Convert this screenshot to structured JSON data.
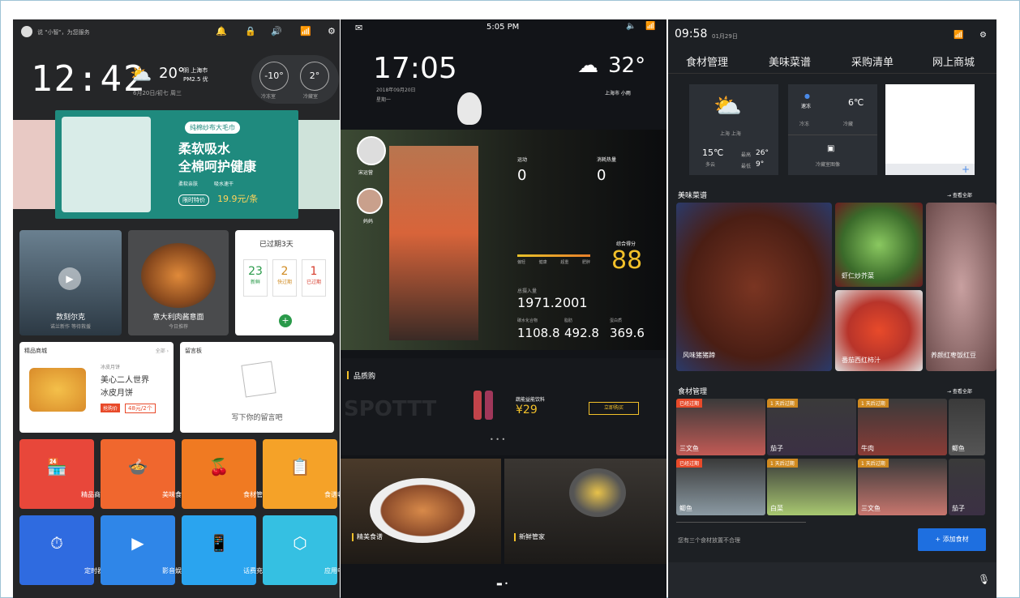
{
  "p1": {
    "status_text": "说 \"小智\"，为您服务",
    "time": "12:42",
    "temp": "20°",
    "weather_mini": "阴  上海市",
    "pm": "PM2.5  优",
    "date": "6月20日/初七  周三",
    "fridge1_temp": "-10°",
    "fridge1_label": "冷冻室",
    "fridge2_temp": "2°",
    "fridge2_label": "冷藏室",
    "banner": {
      "tag": "纯棉纱布大毛巾",
      "line1": "柔软吸水",
      "line2": "全棉呵护健康",
      "feat1": "柔软亲肤",
      "feat2": "吸水速干",
      "price_label": "限时特价",
      "price": "19.9元/条"
    },
    "video1_title": "敦刻尔克",
    "video1_sub": "诺兰新作 等待救援",
    "recipe_title": "意大利肉酱意面",
    "recipe_sub": "今日推荐",
    "expiry": {
      "title": "已过期3天",
      "c1_num": "23",
      "c1_label": "新鲜",
      "c2_num": "2",
      "c2_label": "快过期",
      "c3_num": "1",
      "c3_label": "已过期",
      "add": "+"
    },
    "shop": {
      "title": "精品商城",
      "more": "全部 ›",
      "slogan1": "美心二人世界",
      "slogan2": "冰皮月饼",
      "small": "冰皮月饼",
      "buy": "抢购价",
      "price": "48元/2个"
    },
    "memo": {
      "title": "留言板",
      "hint": "写下你的留言吧"
    },
    "quick": [
      {
        "icon": "🏪",
        "label": "精品商城"
      },
      {
        "icon": "🍲",
        "label": "美味食谱"
      },
      {
        "icon": "🍒",
        "label": "食材管理"
      },
      {
        "icon": "📋",
        "label": "食谱收藏"
      },
      {
        "icon": "⏱",
        "label": "定时器"
      },
      {
        "icon": "▶",
        "label": "影音娱乐"
      },
      {
        "icon": "📱",
        "label": "话费充值"
      },
      {
        "icon": "⬡",
        "label": "应用中心"
      }
    ]
  },
  "p2": {
    "status_time": "5:05 PM",
    "time": "17:05",
    "date": "2018年09月20日",
    "weekday": "星期一",
    "temp": "32°",
    "city": "上海市   小雨",
    "user1": "宋运营",
    "user2": "妈妈",
    "sport_label": "运动",
    "sport_val": "0",
    "cal_label": "消耗热量",
    "cal_val": "0",
    "score_label": "综合得分",
    "score": "88",
    "bar_vals": [
      "偏轻",
      "健康",
      "超重",
      "肥胖"
    ],
    "weight_label": "总摄入量",
    "weight_val": "1971.2001",
    "s1": "1108.8",
    "s2": "492.8",
    "s3": "369.6",
    "s1_label": "碳水化合物",
    "s2_label": "脂肪",
    "s3_label": "蛋白质",
    "shop_title": "品质购",
    "product": "蔬能益能饮料",
    "price": "¥29",
    "buy": "立即购买",
    "watermark": "SPOTTT",
    "card1": "精美食谱",
    "card2": "新鲜管家"
  },
  "p3": {
    "time": "09:58",
    "date": "01月29日",
    "tabs": [
      "食材管理",
      "美味菜谱",
      "采购清单",
      "网上商城"
    ],
    "weather_city": "上海 上海",
    "weather_temp": "15℃",
    "weather_desc": "多云",
    "hi_label": "最高",
    "hi": "26°",
    "lo_label": "最低",
    "lo": "9°",
    "fridge_mode": "速冻",
    "fridge_temp": "6℃",
    "fridge_l1": "冷冻",
    "fridge_l2": "冷藏",
    "fridge_btn": "冷藏室图像",
    "add": "+",
    "recipes_title": "美味菜谱",
    "recipes_more": "→ 查看全部",
    "recipes": [
      "风味猪猪蹄",
      "虾仁炒芥菜",
      "番茄西红柿汁",
      "养颜红枣饭红豆"
    ],
    "food_title": "食材管理",
    "food_more": "→ 查看全部",
    "foods": [
      {
        "tag": "已经过期",
        "name": "三文鱼",
        "color": "#c25a55"
      },
      {
        "tag": "1 天后过期",
        "name": "茄子",
        "color": "#3b3044"
      },
      {
        "tag": "1 天后过期",
        "name": "牛肉",
        "color": "#8a3b36"
      },
      {
        "tag": "",
        "name": "鲫鱼",
        "color": "#555"
      },
      {
        "tag": "已经过期",
        "name": "鲫鱼",
        "color": "#8b9aa3"
      },
      {
        "tag": "1 天后过期",
        "name": "白菜",
        "color": "#a8c870"
      },
      {
        "tag": "1 天后过期",
        "name": "三文鱼",
        "color": "#c8766e"
      },
      {
        "tag": "",
        "name": "茄子",
        "color": "#3b3044"
      }
    ],
    "warning": "您有三个食材放置不合理",
    "add_btn": "+ 添加食材"
  }
}
